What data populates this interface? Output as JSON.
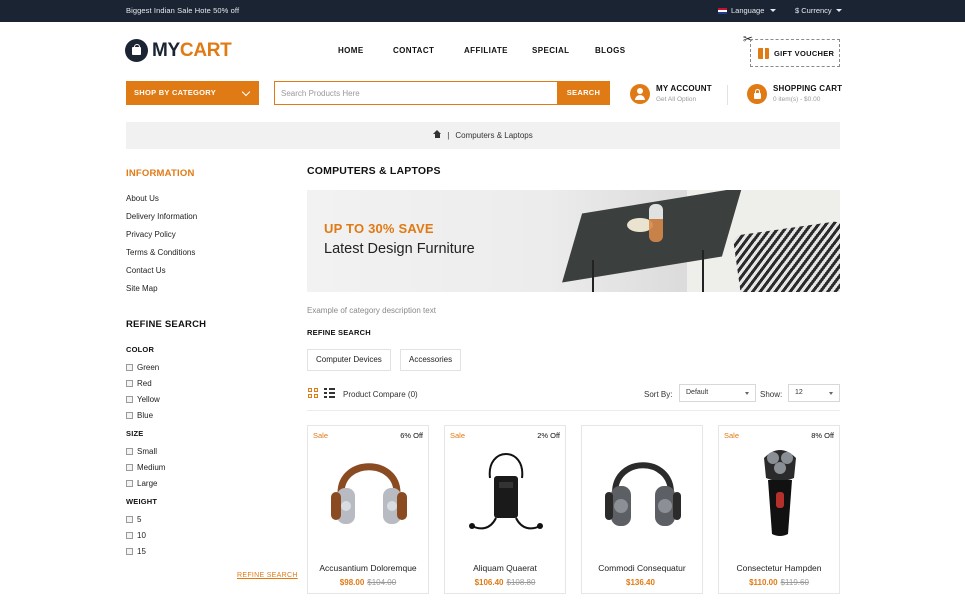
{
  "topbar": {
    "promo": "Biggest Indian Sale Hote 50% off",
    "language": "Language",
    "currency": "$ Currency"
  },
  "header": {
    "logo_part1": "MY",
    "logo_part2": "CART",
    "nav": [
      "HOME",
      "CONTACT",
      "AFFILIATE",
      "SPECIAL",
      "BLOGS"
    ],
    "gift_voucher": "GIFT VOUCHER"
  },
  "searchbar": {
    "category_label": "SHOP BY CATEGORY",
    "placeholder": "Search Products Here",
    "button": "SEARCH"
  },
  "account": {
    "title": "MY ACCOUNT",
    "subtitle": "Get All Option"
  },
  "cart": {
    "title": "SHOPPING CART",
    "subtitle": "0 item(s) - $0.00"
  },
  "breadcrumb": {
    "current": "Computers & Laptops",
    "separator": "|"
  },
  "sidebar": {
    "info_title": "INFORMATION",
    "info_links": [
      "About Us",
      "Delivery Information",
      "Privacy Policy",
      "Terms & Conditions",
      "Contact Us",
      "Site Map"
    ],
    "refine_title": "REFINE SEARCH",
    "color_title": "COLOR",
    "colors": [
      "Green",
      "Red",
      "Yellow",
      "Blue"
    ],
    "size_title": "SIZE",
    "sizes": [
      "Small",
      "Medium",
      "Large"
    ],
    "weight_title": "WEIGHT",
    "weights": [
      "5",
      "10",
      "15"
    ],
    "refine_link": "REFINE SEARCH"
  },
  "main": {
    "title": "COMPUTERS & LAPTOPS",
    "banner_line1": "UP TO 30% SAVE",
    "banner_line2": "Latest Design Furniture",
    "description": "Example of category description text",
    "refine_title": "REFINE SEARCH",
    "chips": [
      "Computer Devices",
      "Accessories"
    ],
    "product_compare": "Product Compare (0)",
    "sort_label": "Sort By:",
    "sort_value": "Default",
    "show_label": "Show:",
    "show_value": "12"
  },
  "colors": {
    "accent": "#e07a14",
    "topbar": "#1b2433"
  },
  "products": [
    {
      "sale": "Sale",
      "off": "6% Off",
      "name": "Accusantium Doloremque",
      "price": "$98.00",
      "old": "$104.00",
      "icon": "headphones-brown"
    },
    {
      "sale": "Sale",
      "off": "2% Off",
      "name": "Aliquam Quaerat",
      "price": "$106.40",
      "old": "$108.80",
      "icon": "audio-player"
    },
    {
      "sale": "",
      "off": "",
      "name": "Commodi Consequatur",
      "price": "$136.40",
      "old": "",
      "icon": "headphones-gray"
    },
    {
      "sale": "Sale",
      "off": "8% Off",
      "name": "Consectetur Hampden",
      "price": "$110.00",
      "old": "$119.60",
      "icon": "shaver"
    }
  ]
}
